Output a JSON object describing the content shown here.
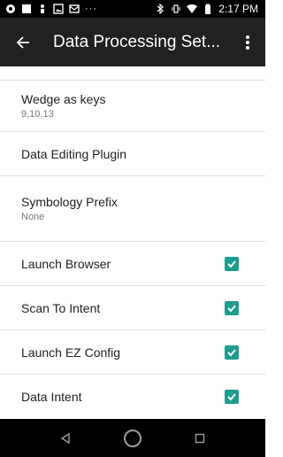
{
  "status_bar": {
    "time": "2:17 PM",
    "overflow": "···",
    "left_icons": [
      "notification-dot-icon",
      "square-icon",
      "person-icon",
      "image-icon",
      "mail-icon"
    ],
    "right_icons": [
      "bluetooth-icon",
      "vibrate-icon",
      "wifi-icon",
      "battery-icon"
    ]
  },
  "app_bar": {
    "title": "Data Processing Set...",
    "back_icon": "arrow-left-icon",
    "more_icon": "more-vert-icon"
  },
  "list": {
    "rows": [
      {
        "title": "Wedge as keys",
        "subtitle": "9,10,13",
        "checkbox": null
      },
      {
        "title": "Data Editing Plugin",
        "subtitle": "",
        "checkbox": null
      },
      {
        "title": "Symbology Prefix",
        "subtitle": "None",
        "checkbox": null
      },
      {
        "title": "Launch Browser",
        "subtitle": "",
        "checkbox": true
      },
      {
        "title": "Scan To Intent",
        "subtitle": "",
        "checkbox": true
      },
      {
        "title": "Launch EZ Config",
        "subtitle": "",
        "checkbox": true
      },
      {
        "title": "Data Intent",
        "subtitle": "",
        "checkbox": true
      }
    ]
  },
  "colors": {
    "accent": "#1a9e8f",
    "app_bar": "#212121",
    "status_bar": "#000000",
    "divider": "#e0e0e0"
  },
  "nav_bar": {
    "buttons": [
      "back-triangle-icon",
      "home-circle-icon",
      "recents-square-icon"
    ]
  }
}
